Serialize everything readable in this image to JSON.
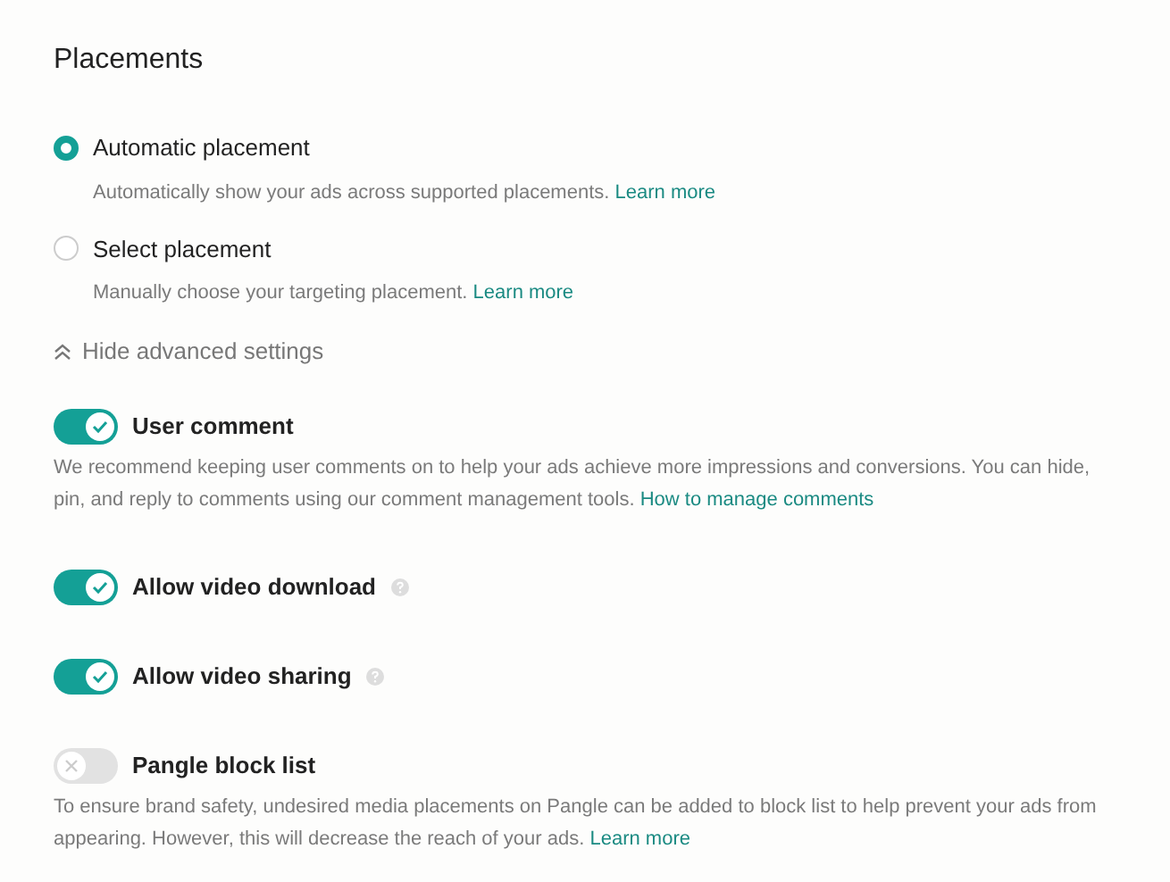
{
  "title": "Placements",
  "placements": [
    {
      "label": "Automatic placement",
      "selected": true,
      "description": "Automatically show your ads across supported placements.",
      "link": "Learn more"
    },
    {
      "label": "Select placement",
      "selected": false,
      "description": "Manually choose your targeting placement.",
      "link": "Learn more"
    }
  ],
  "advanced_toggle": {
    "label": "Hide advanced settings",
    "expanded": true
  },
  "settings": [
    {
      "label": "User comment",
      "on": true,
      "help_icon": false,
      "description": "We recommend keeping user comments on to help your ads achieve more impressions and conversions. You can hide, pin, and reply to comments using our comment management tools.",
      "link": "How to manage comments"
    },
    {
      "label": "Allow video download",
      "on": true,
      "help_icon": true
    },
    {
      "label": "Allow video sharing",
      "on": true,
      "help_icon": true
    },
    {
      "label": "Pangle block list",
      "on": false,
      "help_icon": false,
      "description": "To ensure brand safety, undesired media placements on Pangle can be added to block list to help prevent your ads from appearing. However, this will decrease the reach of your ads.",
      "link": "Learn more"
    }
  ]
}
